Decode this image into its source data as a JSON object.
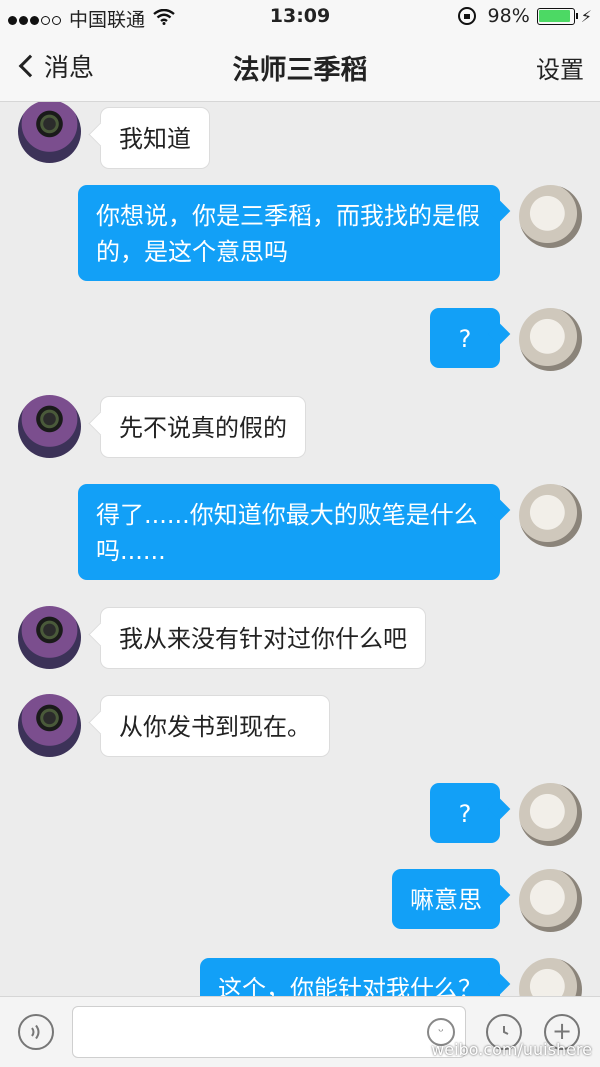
{
  "status": {
    "carrier": "中国联通",
    "time": "13:09",
    "battery": "98%",
    "battery_level": 0.98,
    "signal_dots": 5,
    "signal_filled": 3
  },
  "nav": {
    "back_label": "消息",
    "title": "法师三季稻",
    "settings_label": "设置"
  },
  "messages": [
    {
      "side": "left",
      "text": "我知道"
    },
    {
      "side": "right",
      "text": "你想说，你是三季稻，而我找的是假的，是这个意思吗"
    },
    {
      "side": "right",
      "text": "?"
    },
    {
      "side": "left",
      "text": "先不说真的假的"
    },
    {
      "side": "right",
      "text": "得了......你知道你最大的败笔是什么吗......"
    },
    {
      "side": "left",
      "text": "我从来没有针对过你什么吧"
    },
    {
      "side": "left",
      "text": "从你发书到现在。"
    },
    {
      "side": "right",
      "text": "?"
    },
    {
      "side": "right",
      "text": "嘛意思"
    },
    {
      "side": "right",
      "text": "这个，你能针对我什么？"
    }
  ],
  "input": {
    "value": "",
    "placeholder": ""
  },
  "icons": {
    "voice": "voice-icon",
    "emoji": "emoji-icon",
    "clock": "clock-icon",
    "plus": "plus-icon"
  },
  "watermark": "weibo.com/uuishere",
  "colors": {
    "bubble_outgoing": "#12a0f7",
    "bubble_incoming": "#ffffff",
    "background": "#ececec"
  }
}
